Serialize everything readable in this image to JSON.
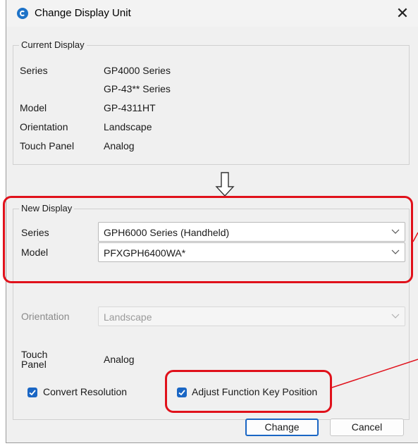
{
  "window": {
    "title": "Change Display Unit",
    "close_glyph": "✕"
  },
  "current_display": {
    "legend": "Current Display",
    "series_label": "Series",
    "series_value_1": "GP4000 Series",
    "series_value_2": "GP-43** Series",
    "model_label": "Model",
    "model_value": "GP-4311HT",
    "orientation_label": "Orientation",
    "orientation_value": "Landscape",
    "touch_panel_label": "Touch Panel",
    "touch_panel_value": "Analog"
  },
  "new_display": {
    "legend": "New Display",
    "series_label": "Series",
    "series_selected": "GPH6000 Series (Handheld)",
    "model_label": "Model",
    "model_selected": "PFXGPH6400WA*",
    "orientation_label": "Orientation",
    "orientation_selected": "Landscape",
    "touch_label_1": "Touch",
    "touch_label_2": "Panel",
    "touch_value": "Analog"
  },
  "options": {
    "convert_resolution": {
      "label": "Convert Resolution",
      "checked": true
    },
    "adjust_function_key": {
      "label": "Adjust Function Key Position",
      "checked": true
    }
  },
  "buttons": {
    "change": "Change",
    "cancel": "Cancel"
  },
  "colors": {
    "highlight": "#e0111b",
    "accent": "#1a66c4",
    "dialog_bg": "#f0f0f0"
  },
  "icons": {
    "app": "app-logo-icon",
    "close": "close-icon",
    "dropdown": "chevron-down-icon",
    "arrow": "arrow-down-icon",
    "check": "checkmark-icon"
  }
}
